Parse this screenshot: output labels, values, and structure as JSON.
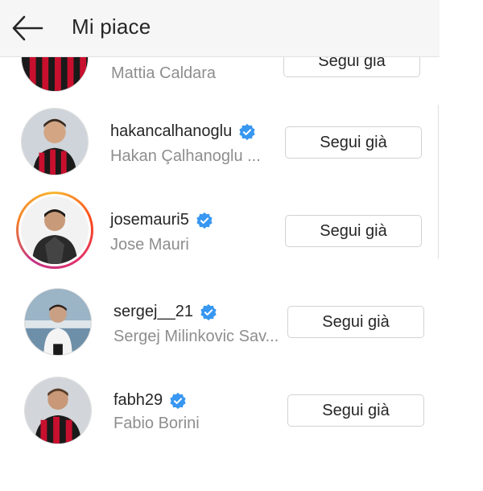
{
  "header": {
    "title": "Mi piace",
    "back_icon": "arrow-left-icon"
  },
  "colors": {
    "verified": "#3897f0",
    "muted": "#8e8e8e",
    "text": "#262626"
  },
  "users": [
    {
      "username": "",
      "fullname": "Mattia Caldara",
      "button": "Segui già",
      "verified": false
    },
    {
      "username": "hakancalhanoglu",
      "fullname": "Hakan Çalhanoglu ...",
      "button": "Segui già",
      "verified": true
    },
    {
      "username": "josemauri5",
      "fullname": "Jose Mauri",
      "button": "Segui già",
      "verified": true,
      "has_story": true
    },
    {
      "username": "sergej__21",
      "fullname": "Sergej Milinkovic Sav...",
      "button": "Segui già",
      "verified": true
    },
    {
      "username": "fabh29",
      "fullname": "Fabio Borini",
      "button": "Segui già",
      "verified": true
    }
  ]
}
